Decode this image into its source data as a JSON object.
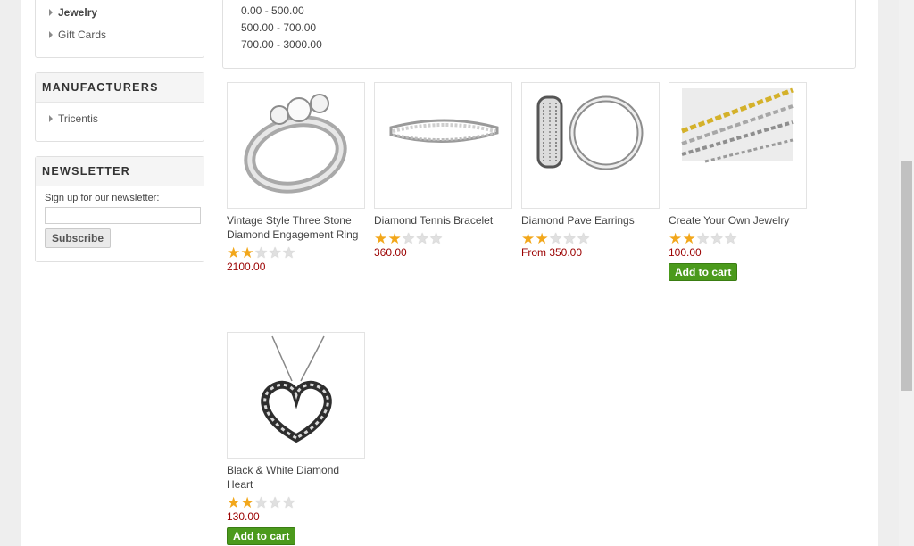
{
  "categories": {
    "items": [
      {
        "label": "Jewelry",
        "active": true
      },
      {
        "label": "Gift Cards",
        "active": false
      }
    ]
  },
  "manufacturers": {
    "title": "MANUFACTURERS",
    "items": [
      {
        "label": "Tricentis"
      }
    ]
  },
  "newsletter": {
    "title": "NEWSLETTER",
    "label": "Sign up for our newsletter:",
    "input_value": "",
    "subscribe_label": "Subscribe"
  },
  "price_filter": {
    "ranges": [
      "0.00 - 500.00",
      "500.00 - 700.00",
      "700.00 - 3000.00"
    ]
  },
  "products": [
    {
      "title": "Vintage Style Three Stone Diamond Engagement Ring",
      "rating": 2,
      "price": "2100.00",
      "add_to_cart": null,
      "icon": "ring-image"
    },
    {
      "title": "Diamond Tennis Bracelet",
      "rating": 2,
      "price": "360.00",
      "add_to_cart": null,
      "icon": "bracelet-image"
    },
    {
      "title": "Diamond Pave Earrings",
      "rating": 2,
      "price": "From 350.00",
      "add_to_cart": null,
      "icon": "earrings-image"
    },
    {
      "title": "Create Your Own Jewelry",
      "rating": 2,
      "price": "100.00",
      "add_to_cart": "Add to cart",
      "icon": "chains-image"
    },
    {
      "title": "Black & White Diamond Heart",
      "rating": 2,
      "price": "130.00",
      "add_to_cart": "Add to cart",
      "icon": "heart-pendant-image"
    }
  ],
  "colors": {
    "price": "#9b0000",
    "add_to_cart": "#4b9a1c",
    "star_on": "#f2a71b"
  }
}
